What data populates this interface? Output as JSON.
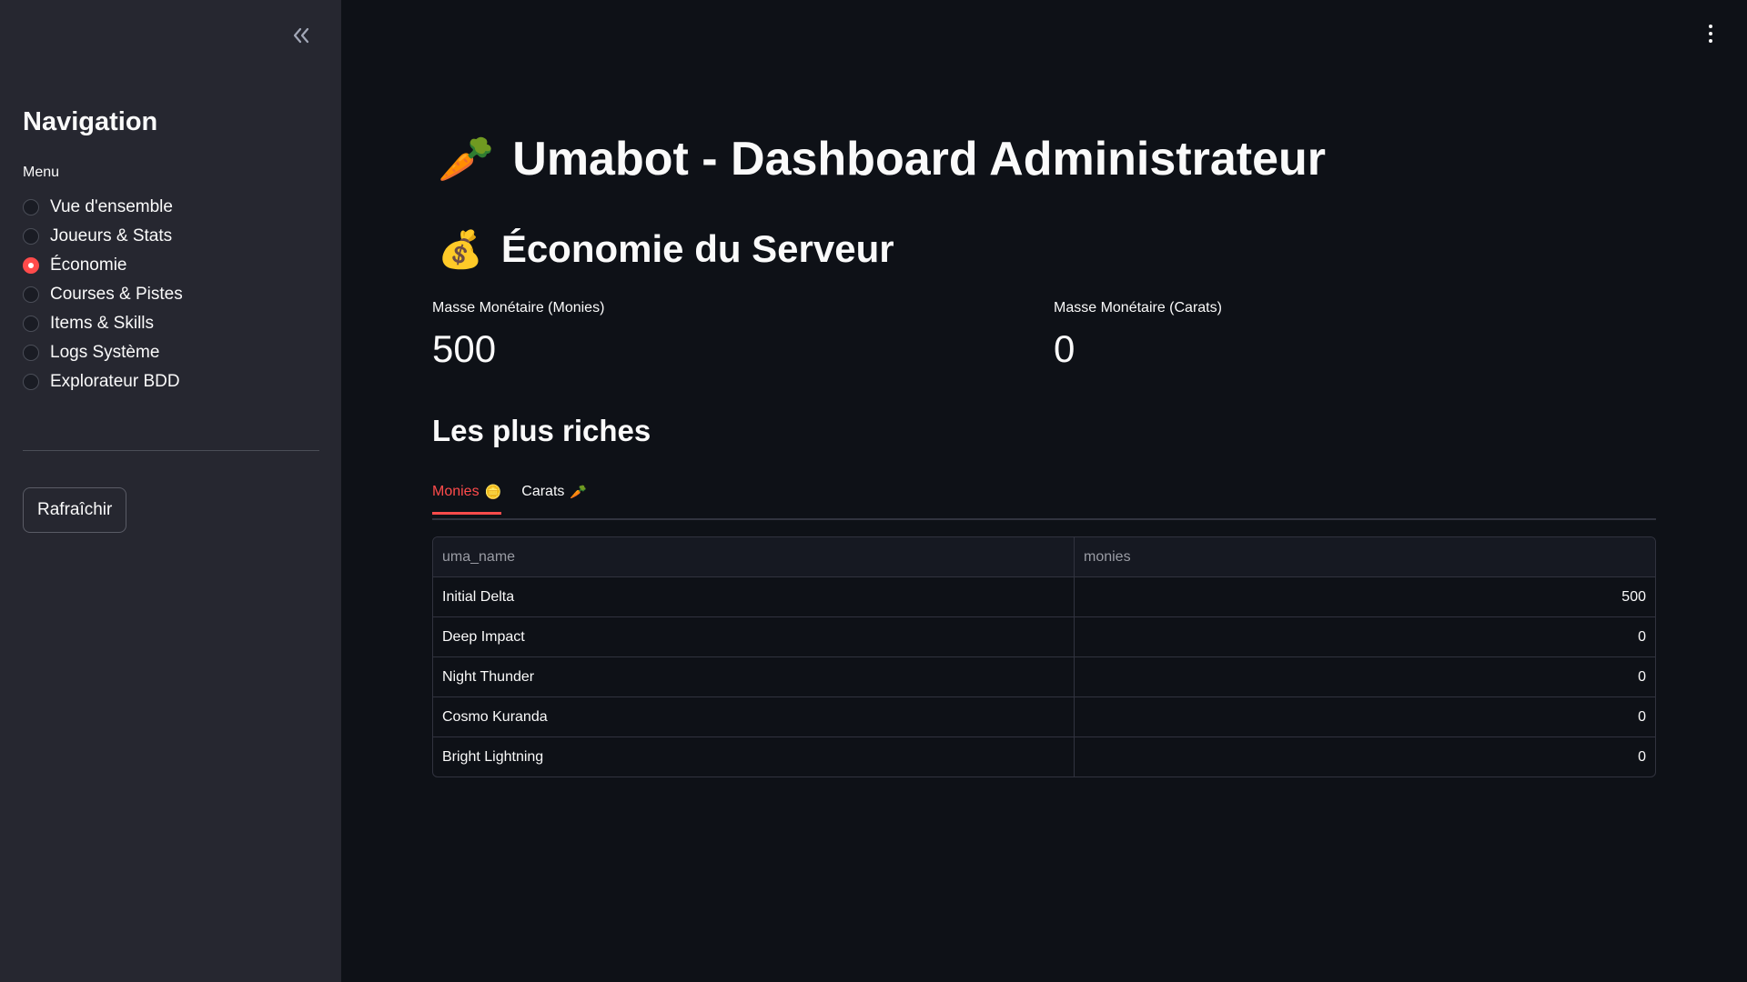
{
  "sidebar": {
    "collapse_icon": "double-chevron-left-icon",
    "title": "Navigation",
    "menu_label": "Menu",
    "items": [
      {
        "label": "Vue d'ensemble",
        "selected": false
      },
      {
        "label": "Joueurs & Stats",
        "selected": false
      },
      {
        "label": "Économie",
        "selected": true
      },
      {
        "label": "Courses & Pistes",
        "selected": false
      },
      {
        "label": "Items & Skills",
        "selected": false
      },
      {
        "label": "Logs Système",
        "selected": false
      },
      {
        "label": "Explorateur BDD",
        "selected": false
      }
    ],
    "refresh_label": "Rafraîchir"
  },
  "main": {
    "menu_icon": "kebab-menu-icon",
    "title_emoji": "🥕",
    "title": "Umabot - Dashboard Administrateur",
    "section_emoji": "💰",
    "section_title": "Économie du Serveur",
    "metrics": [
      {
        "label": "Masse Monétaire (Monies)",
        "value": "500"
      },
      {
        "label": "Masse Monétaire (Carats)",
        "value": "0"
      }
    ],
    "richest_title": "Les plus riches",
    "tabs": [
      {
        "label": "Monies",
        "emoji": "🪙",
        "active": true
      },
      {
        "label": "Carats",
        "emoji": "🥕",
        "active": false
      }
    ],
    "table": {
      "columns": [
        "uma_name",
        "monies"
      ],
      "rows": [
        {
          "uma_name": "Initial Delta",
          "monies": "500"
        },
        {
          "uma_name": "Deep Impact",
          "monies": "0"
        },
        {
          "uma_name": "Night Thunder",
          "monies": "0"
        },
        {
          "uma_name": "Cosmo Kuranda",
          "monies": "0"
        },
        {
          "uma_name": "Bright Lightning",
          "monies": "0"
        }
      ]
    }
  },
  "colors": {
    "accent": "#ff4b4b",
    "background": "#0e1117",
    "sidebar": "#262730"
  }
}
